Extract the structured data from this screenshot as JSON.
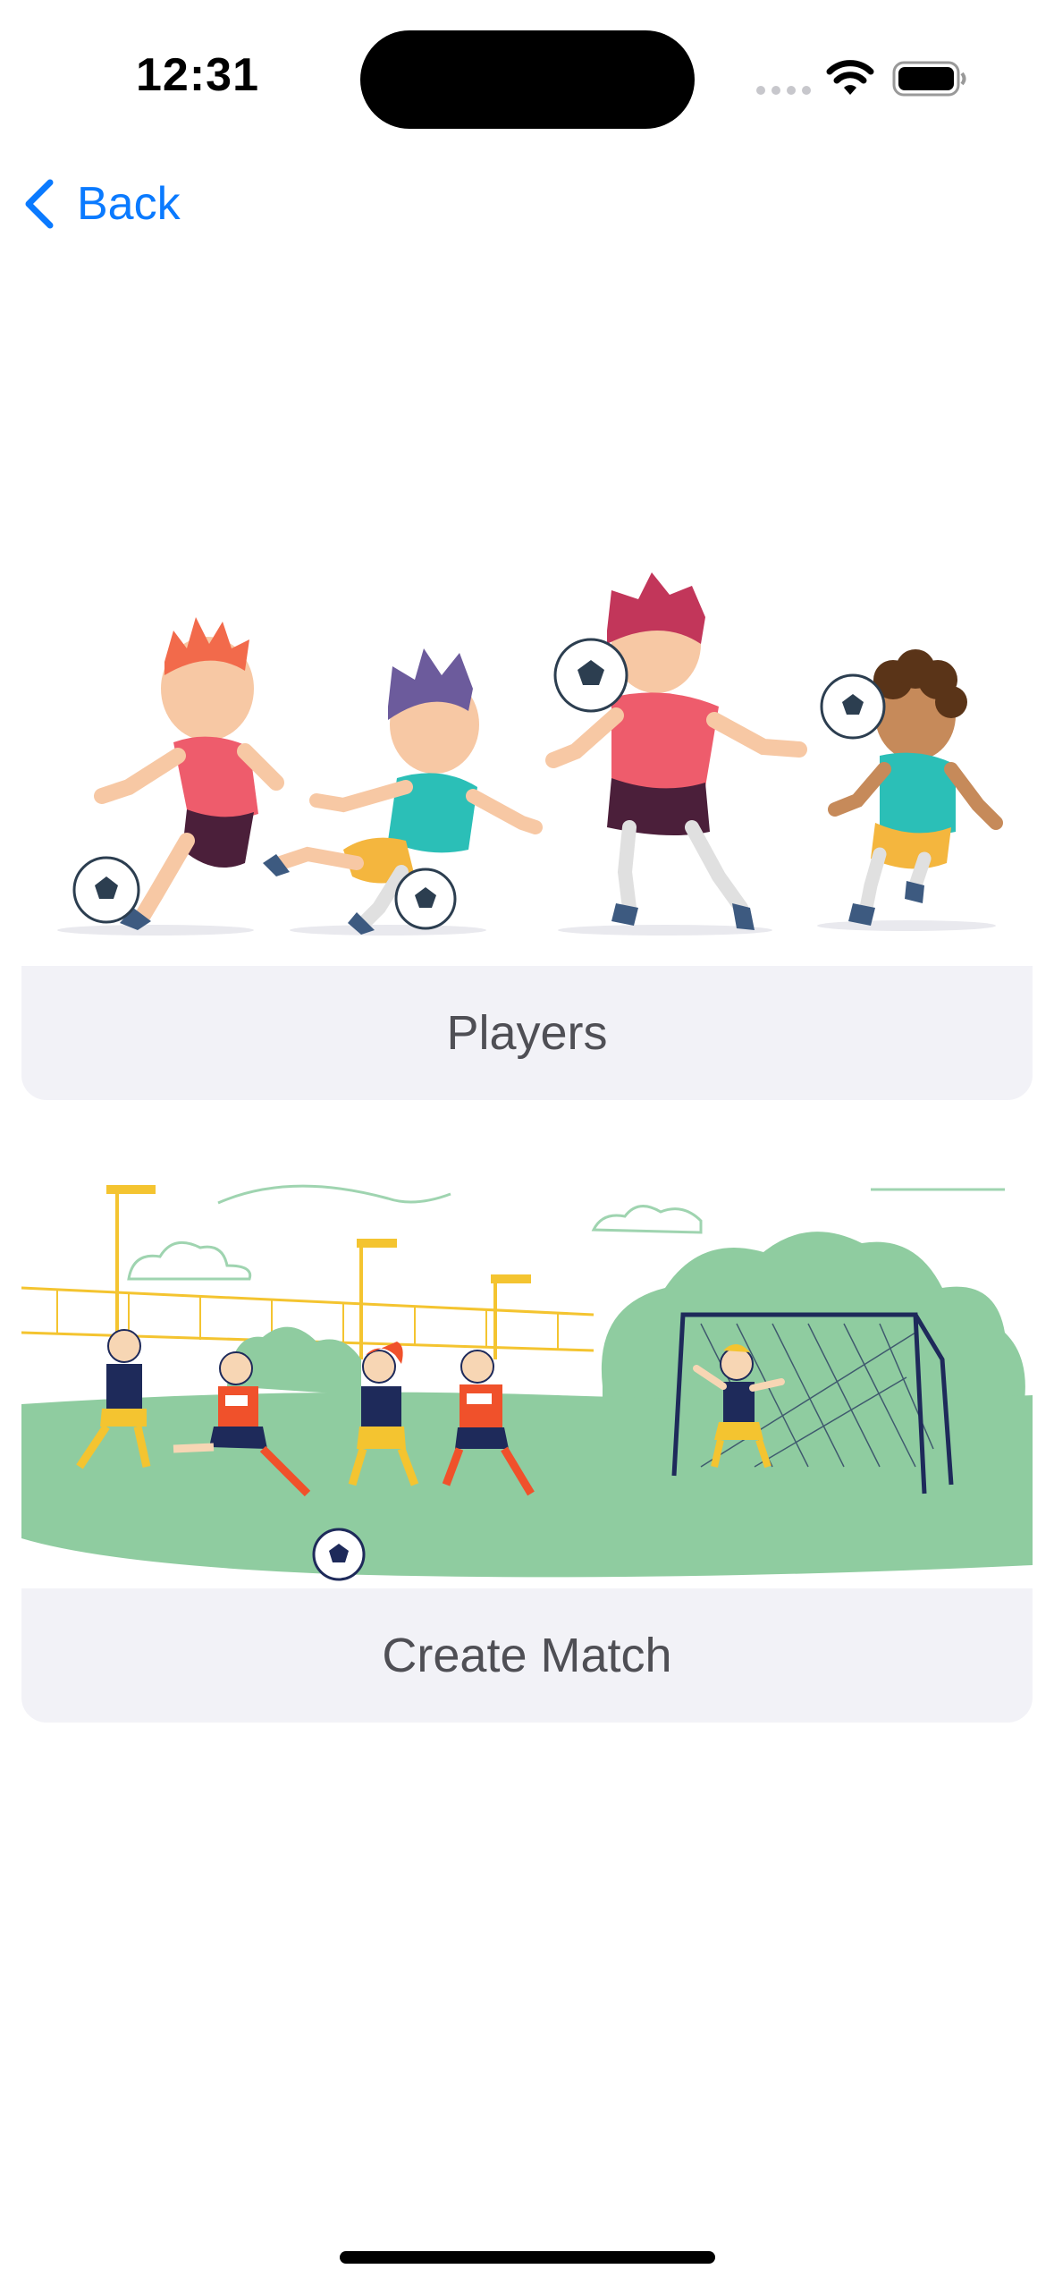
{
  "status_bar": {
    "time": "12:31"
  },
  "nav": {
    "back_label": "Back"
  },
  "cards": [
    {
      "label": "Players",
      "image": "kids-playing-soccer-illustration"
    },
    {
      "label": "Create Match",
      "image": "soccer-match-with-goalkeeper-illustration"
    }
  ],
  "colors": {
    "accent": "#0a7aff",
    "card_bar": "#f2f2f7",
    "label_text": "#4f4f55",
    "field_green": "#8fcca0"
  },
  "icons": [
    "chevron-left-icon",
    "wifi-icon",
    "battery-icon",
    "cellular-signal-icon"
  ]
}
